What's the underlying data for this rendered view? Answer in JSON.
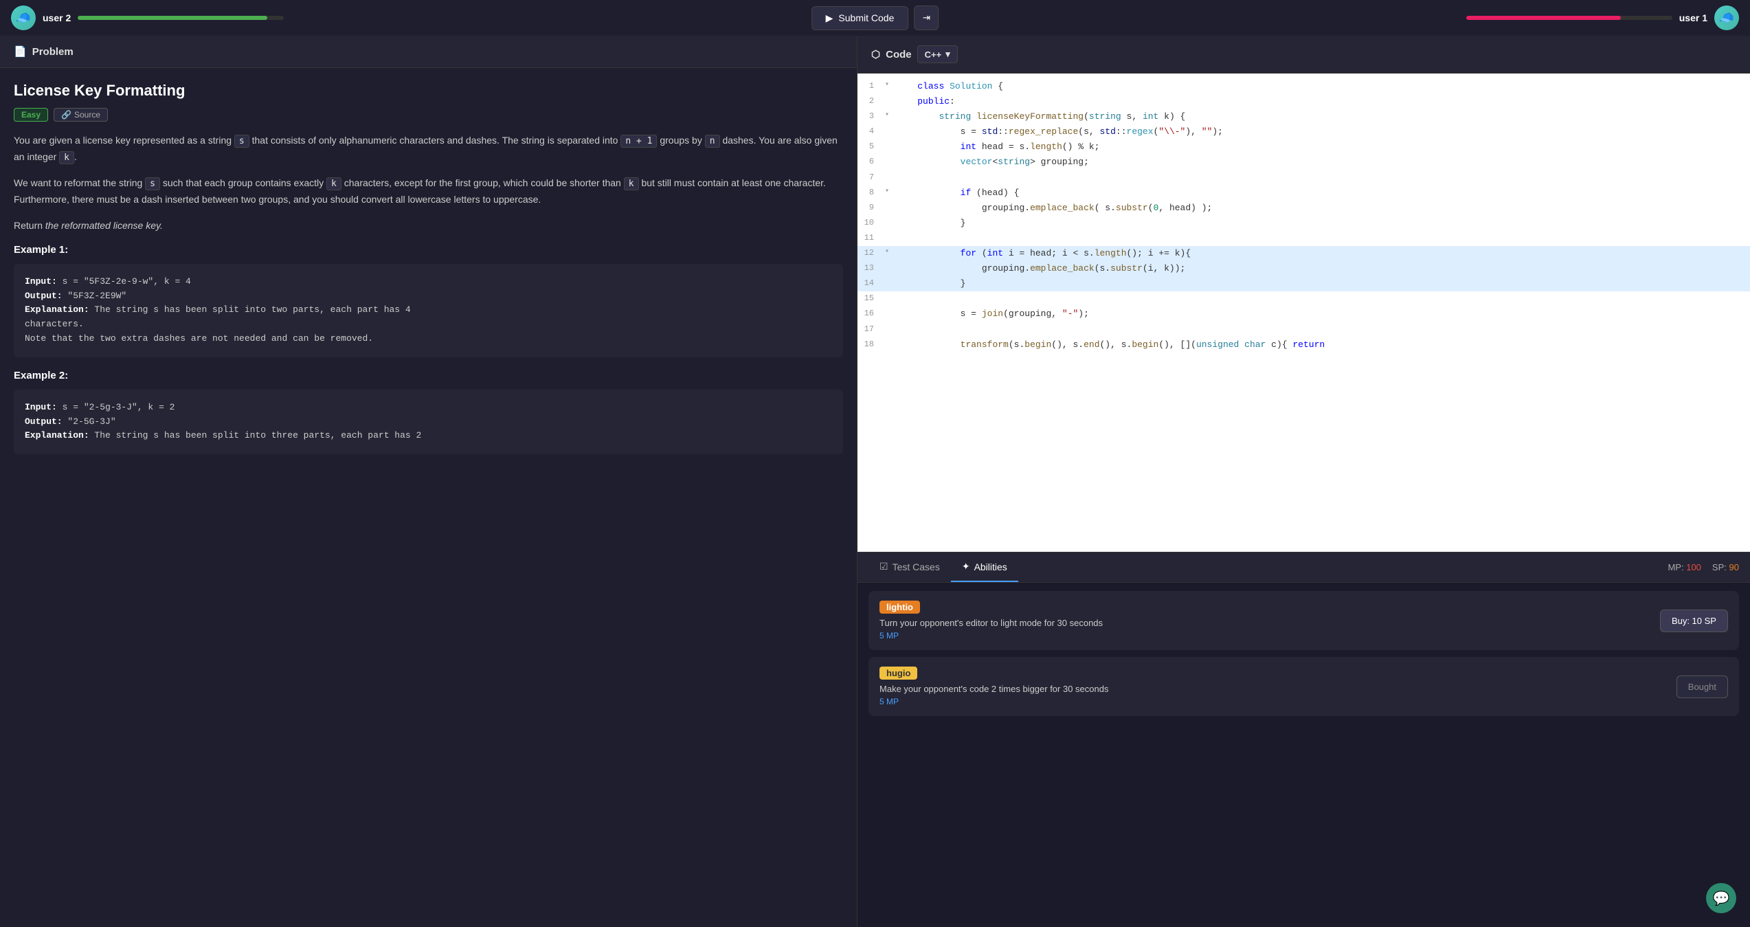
{
  "topbar": {
    "user_left": {
      "name": "user 2",
      "avatar_emoji": "🧢",
      "progress": 92
    },
    "user_right": {
      "name": "user 1",
      "avatar_emoji": "🧢",
      "progress": 75
    },
    "submit_btn": "Submit Code"
  },
  "problem_panel": {
    "header": "Problem",
    "title": "License Key Formatting",
    "badge_easy": "Easy",
    "badge_source": "Source",
    "description_1": "You are given a license key represented as a string",
    "inline_s1": "s",
    "description_2": "that consists of only alphanumeric characters and dashes. The string is separated into",
    "inline_n1": "n + 1",
    "description_3": "groups by",
    "inline_n2": "n",
    "description_4": "dashes. You are also given an integer",
    "inline_k1": "k",
    "description_5": ".",
    "description_6": "We want to reformat the string",
    "inline_s2": "s",
    "description_7": "such that each group contains exactly",
    "inline_k2": "k",
    "description_8": "characters, except for the first group, which could be shorter than",
    "inline_k3": "k",
    "description_9": "but still must contain at least one character. Furthermore, there must be a dash inserted between two groups, and you should convert all lowercase letters to uppercase.",
    "return_text": "Return",
    "return_italic": "the reformatted license key.",
    "example1_title": "Example 1:",
    "example1_code": "Input: s = \"5F3Z-2e-9-w\", k = 4\nOutput: \"5F3Z-2E9W\"\nExplanation: The string s has been split into two parts, each part has 4\ncharacters.\nNote that the two extra dashes are not needed and can be removed.",
    "example2_title": "Example 2:",
    "example2_code": "Input: s = \"2-5g-3-J\", k = 2\nOutput: \"2-5G-3J\"\nExplanation: The string s has been split into three parts, each part has 2"
  },
  "code_panel": {
    "header": "Code",
    "language": "C++",
    "lines": [
      {
        "num": 1,
        "toggle": "v",
        "code": "    class Solution {"
      },
      {
        "num": 2,
        "toggle": "",
        "code": "    public:"
      },
      {
        "num": 3,
        "toggle": "v",
        "code": "        string licenseKeyFormatting(string s, int k) {"
      },
      {
        "num": 4,
        "toggle": "",
        "code": "            s = std::regex_replace(s, std::regex(\"\\-\"), \"\");"
      },
      {
        "num": 5,
        "toggle": "",
        "code": "            int head = s.length() % k;"
      },
      {
        "num": 6,
        "toggle": "",
        "code": "            vector<string> grouping;"
      },
      {
        "num": 7,
        "toggle": "",
        "code": ""
      },
      {
        "num": 8,
        "toggle": "v",
        "code": "            if (head) {"
      },
      {
        "num": 9,
        "toggle": "",
        "code": "                grouping.emplace_back( s.substr(0, head) );"
      },
      {
        "num": 10,
        "toggle": "",
        "code": "            }"
      },
      {
        "num": 11,
        "toggle": "",
        "code": ""
      },
      {
        "num": 12,
        "toggle": "v",
        "code": "            for (int i = head; i < s.length(); i += k){",
        "highlight": true
      },
      {
        "num": 13,
        "toggle": "",
        "code": "                grouping.emplace_back(s.substr(i, k));",
        "highlight": true
      },
      {
        "num": 14,
        "toggle": "",
        "code": "            }",
        "highlight": true
      },
      {
        "num": 15,
        "toggle": "",
        "code": ""
      },
      {
        "num": 16,
        "toggle": "",
        "code": "            s = join(grouping, \"-\");"
      },
      {
        "num": 17,
        "toggle": "",
        "code": ""
      },
      {
        "num": 18,
        "toggle": "",
        "code": "            transform(s.begin(), s.end(), s.begin(), [](unsigned char c){ return"
      }
    ]
  },
  "bottom_panel": {
    "tabs": [
      {
        "label": "Test Cases",
        "icon": "✓",
        "active": false
      },
      {
        "label": "Abilities",
        "icon": "✦",
        "active": true
      }
    ],
    "mp_label": "MP:",
    "mp_value": "100",
    "sp_label": "SP:",
    "sp_value": "90",
    "abilities": [
      {
        "tag": "lightio",
        "tag_color": "orange",
        "desc": "Turn your opponent's editor to light mode for 30 seconds",
        "cost": "5 MP",
        "btn_label": "Buy: 10 SP",
        "bought": false
      },
      {
        "tag": "hugio",
        "tag_color": "yellow",
        "desc": "Make your opponent's code 2 times bigger for 30 seconds",
        "cost": "5 MP",
        "btn_label": "Bought",
        "bought": true
      }
    ]
  },
  "chat": {
    "icon": "💬"
  }
}
